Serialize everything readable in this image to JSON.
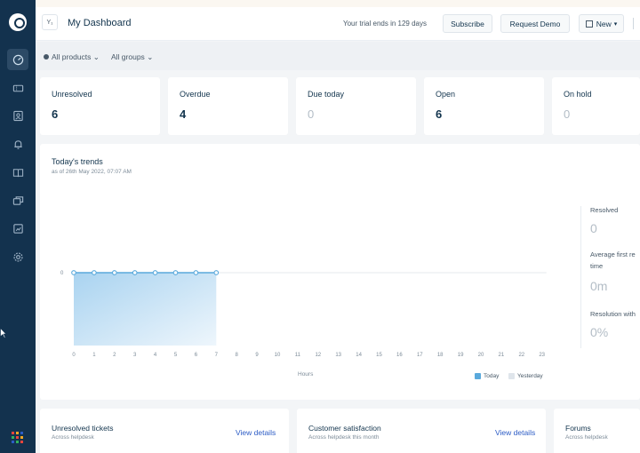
{
  "header": {
    "page_title": "My Dashboard",
    "page_icon_text": "Y₁",
    "trial_text": "Your trial ends in 129 days",
    "subscribe_label": "Subscribe",
    "request_demo_label": "Request Demo",
    "new_label": "New"
  },
  "filters": {
    "products": "All products",
    "groups": "All groups"
  },
  "metrics": [
    {
      "label": "Unresolved",
      "value": "6"
    },
    {
      "label": "Overdue",
      "value": "4"
    },
    {
      "label": "Due today",
      "value": "0"
    },
    {
      "label": "Open",
      "value": "6"
    },
    {
      "label": "On hold",
      "value": "0"
    }
  ],
  "trends": {
    "title": "Today's trends",
    "subtitle": "as of 26th May 2022, 07:07 AM",
    "x_axis_title": "Hours",
    "legend_today": "Today",
    "legend_yesterday": "Yesterday",
    "stats": [
      {
        "label": "Resolved",
        "value": "0"
      },
      {
        "label": "Average first re\ntime",
        "value": "0m"
      },
      {
        "label": "Resolution with",
        "value": "0%"
      }
    ]
  },
  "chart_data": {
    "type": "area",
    "x": [
      0,
      1,
      2,
      3,
      4,
      5,
      6,
      7,
      8,
      9,
      10,
      11,
      12,
      13,
      14,
      15,
      16,
      17,
      18,
      19,
      20,
      21,
      22,
      23
    ],
    "xlabel": "Hours",
    "y_ticks": [
      "0"
    ],
    "series": [
      {
        "name": "Today",
        "x": [
          0,
          1,
          2,
          3,
          4,
          5,
          6,
          7
        ],
        "values": [
          0,
          0,
          0,
          0,
          0,
          0,
          0,
          0
        ]
      }
    ],
    "colors": {
      "today": "#5aa9dc",
      "yesterday": "#c9d3dc"
    },
    "legend": "bottom-right",
    "grid": false
  },
  "bottom_cards": [
    {
      "title": "Unresolved tickets",
      "subtitle": "Across helpdesk",
      "link": "View details"
    },
    {
      "title": "Customer satisfaction",
      "subtitle": "Across helpdesk this month",
      "link": "View details"
    },
    {
      "title": "Forums",
      "subtitle": "Across helpdesk",
      "link": ""
    }
  ],
  "sidebar": {
    "icons": [
      "dashboard-icon",
      "tickets-icon",
      "contacts-icon",
      "alerts-icon",
      "solutions-icon",
      "forums-icon",
      "reports-icon",
      "settings-icon"
    ],
    "app_grid_colors": [
      "#e8453c",
      "#f7a823",
      "#2c5cc5",
      "#31b05b",
      "#e8453c",
      "#f7a823",
      "#2c5cc5",
      "#31b05b",
      "#e8453c"
    ]
  },
  "colors": {
    "sidebar": "#13324e",
    "accent": "#5aa9dc",
    "link": "#2c5cc5"
  }
}
